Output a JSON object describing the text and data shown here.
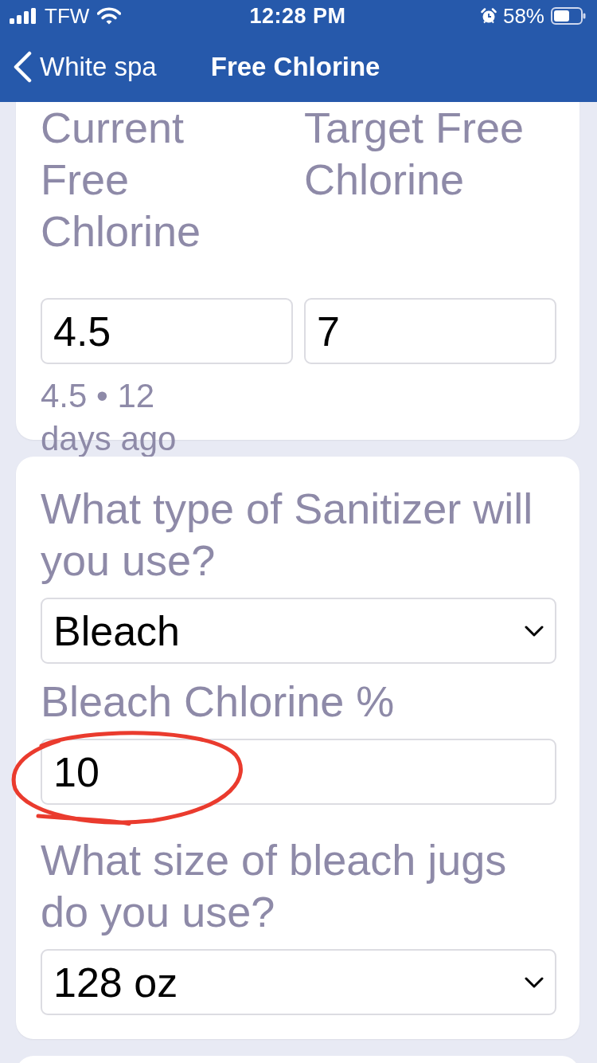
{
  "status_bar": {
    "carrier": "TFW",
    "time": "12:28 PM",
    "battery": "58%"
  },
  "nav_bar": {
    "back_label": "White spa",
    "title": "Free Chlorine"
  },
  "cards": [
    {
      "kind": "pair",
      "fields": [
        {
          "label": "Current Free Chlorine",
          "kind": "input",
          "value": "4.5",
          "hint": "4.5 • 12 days ago",
          "circled": false
        },
        {
          "label": "Target Free Chlorine",
          "kind": "input",
          "value": "7",
          "circled": false
        }
      ]
    },
    {
      "kind": "stack",
      "fields": [
        {
          "label": "What type of Sanitizer will you use?",
          "kind": "select",
          "value": "Bleach",
          "circled": false
        },
        {
          "label": "Bleach Chlorine %",
          "kind": "input",
          "value": "10",
          "circled": true
        },
        {
          "label": "What size of bleach jugs do you use?",
          "kind": "select",
          "value": "128 oz",
          "circled": false
        }
      ]
    }
  ]
}
